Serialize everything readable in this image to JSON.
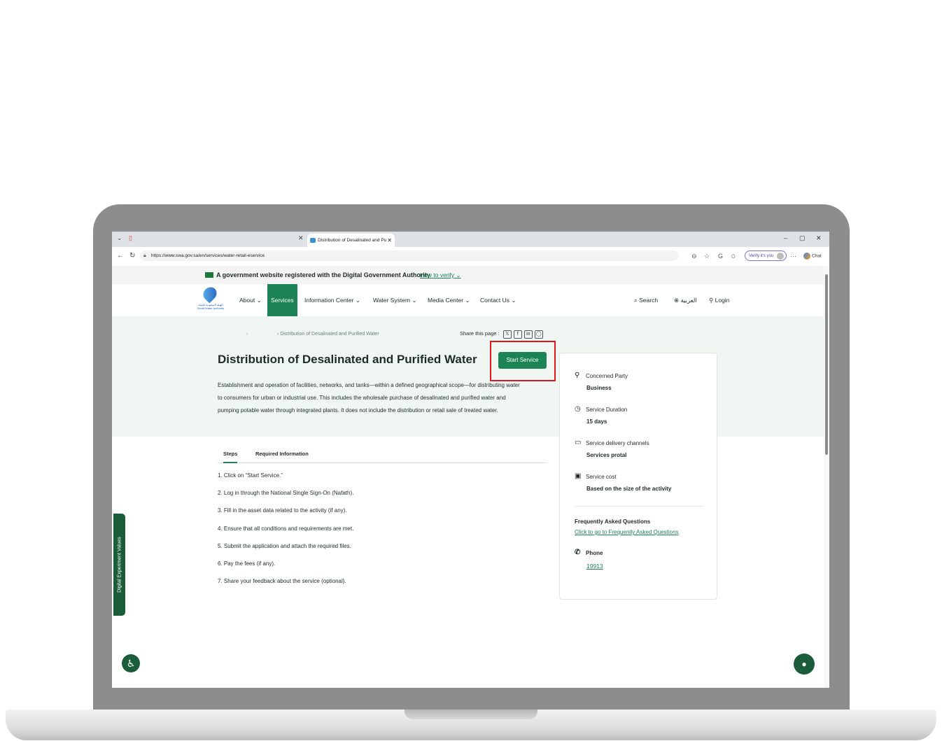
{
  "browser": {
    "tab_title": "Distribution of Desalinated and Pu",
    "url": "https://www.swa.gov.sa/en/services/water-retail-eservice",
    "verify_label": "Verify it's you",
    "chat_label": "Chat",
    "ellipsis": "···"
  },
  "gov_banner": {
    "text": "A government website registered with the Digital Government Authority",
    "how_to_verify": "How to verify"
  },
  "nav": {
    "logo_text": "الهيئة السعودية للمياه Saudi Water Authority",
    "items": [
      {
        "label": "About"
      },
      {
        "label": "Services"
      },
      {
        "label": "Information Center"
      },
      {
        "label": "Water System"
      },
      {
        "label": "Media Center"
      },
      {
        "label": "Contact Us"
      }
    ],
    "search": "Search",
    "language": "العربية",
    "login": "Login"
  },
  "hero": {
    "breadcrumb_current": "Distribution of Desalinated and Purified Water",
    "share_label": "Share this page :",
    "title": "Distribution of Desalinated and Purified Water",
    "start_button": "Start Service",
    "description_lines": [
      "Establishment and operation of facilities, networks, and tanks—within a defined geographical scope—for distributing water",
      "to consumers for urban or industrial use. This includes the wholesale purchase of desalinated and purified water and",
      "pumping potable water through integrated plants. It does not include the distribution or retail sale of treated water."
    ]
  },
  "tabs": {
    "steps": "Steps",
    "required": "Required Information"
  },
  "steps": [
    "1. Click on “Start Service.”",
    "2. Log in through the National Single Sign-On (Nafath).",
    "3. Fill in the asset data related to the activity (if any).",
    "4. Ensure that all conditions and requirements are met.",
    "5. Submit the application and attach the required files.",
    "6. Pay the fees (if any).",
    "7. Share your feedback about the service (optional)."
  ],
  "card": {
    "concerned_party_label": "Concerned Party",
    "concerned_party_value": "Business",
    "duration_label": "Service Duration",
    "duration_value": "15 days",
    "channels_label": "Service delivery channels",
    "channels_value": "Services protal",
    "cost_label": "Service cost",
    "cost_value": "Based on the size of the activity",
    "faq_title": "Frequently Asked Questions",
    "faq_link": "Click to go to Frequently Asked Questions",
    "phone_label": "Phone",
    "phone_value": "19913"
  },
  "side_tab": "Digital Experiment Values",
  "colors": {
    "brand_green": "#1b8354",
    "dark_green": "#1b5d3a",
    "hero_bg": "#f0f7f2",
    "highlight": "#e0181b"
  }
}
